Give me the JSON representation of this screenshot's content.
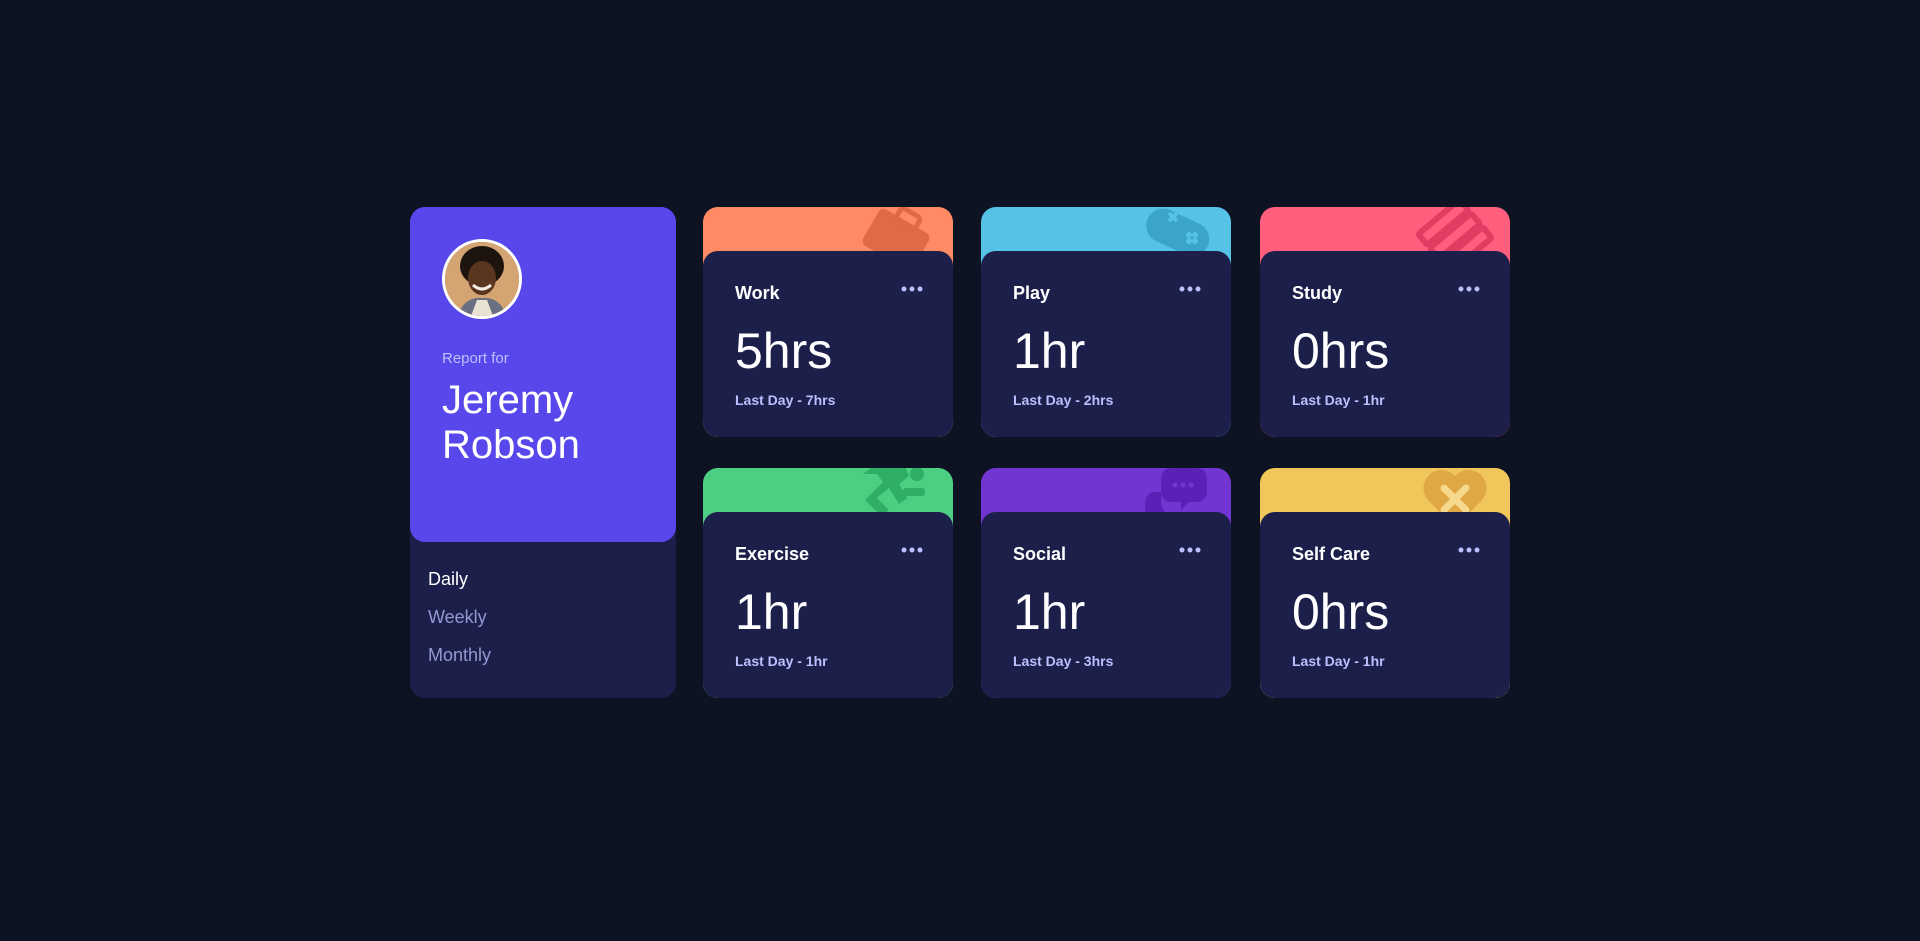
{
  "profile": {
    "report_for": "Report for",
    "name": "Jeremy Robson"
  },
  "periods": [
    {
      "label": "Daily",
      "active": true
    },
    {
      "label": "Weekly",
      "active": false
    },
    {
      "label": "Monthly",
      "active": false
    }
  ],
  "cards": [
    {
      "title": "Work",
      "hours": "5hrs",
      "previous": "Last Day - 7hrs",
      "color": "#ff8b64",
      "icon": "briefcase-icon"
    },
    {
      "title": "Play",
      "hours": "1hr",
      "previous": "Last Day - 2hrs",
      "color": "#55c2e6",
      "icon": "gamepad-icon"
    },
    {
      "title": "Study",
      "hours": "0hrs",
      "previous": "Last Day - 1hr",
      "color": "#ff5e7d",
      "icon": "book-icon"
    },
    {
      "title": "Exercise",
      "hours": "1hr",
      "previous": "Last Day - 1hr",
      "color": "#4bcf82",
      "icon": "running-icon"
    },
    {
      "title": "Social",
      "hours": "1hr",
      "previous": "Last Day - 3hrs",
      "color": "#7335d2",
      "icon": "chat-icon"
    },
    {
      "title": "Self Care",
      "hours": "0hrs",
      "previous": "Last Day - 1hr",
      "color": "#f1c75b",
      "icon": "heart-bandage-icon"
    }
  ],
  "colors": {
    "background": "#0e1323",
    "card": "#1c1f4a",
    "profile_accent": "#5847eb",
    "muted_text": "#bbc0ff"
  }
}
